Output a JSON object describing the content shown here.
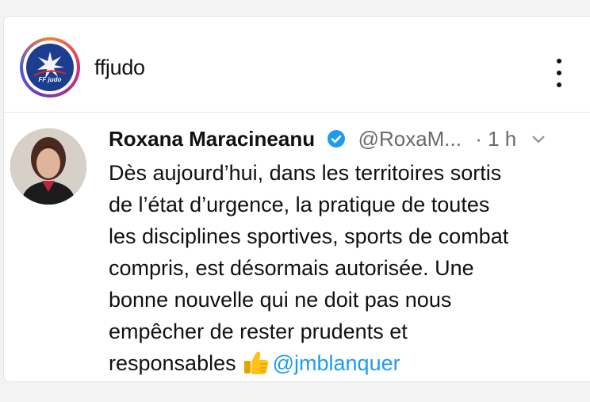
{
  "post": {
    "account_name": "ffjudo",
    "logo_text": "FF judo",
    "icons": {
      "avatar": "ffjudo-logo",
      "more": "more-vertical-icon"
    }
  },
  "tweet": {
    "author_name": "Roxana Maracineanu",
    "handle": "@RoxaM...",
    "time": "· 1 h",
    "icons": {
      "verified": "verified-badge-icon",
      "menu": "chevron-down-icon",
      "emoji": "thumbs-up-emoji"
    },
    "lines": [
      "Dès aujourd’hui, dans les territoires sortis",
      "de l’état d’urgence, la pratique de toutes",
      "les disciplines sportives, sports de combat",
      "compris, est désormais autorisée. Une",
      "bonne nouvelle qui ne doit pas nous",
      "empêcher de rester prudents et"
    ],
    "last_line_text": "responsables",
    "mention": "@jmblanquer"
  },
  "colors": {
    "accent": "#1d9bf0",
    "logo_bg": "#1d3d8f"
  }
}
